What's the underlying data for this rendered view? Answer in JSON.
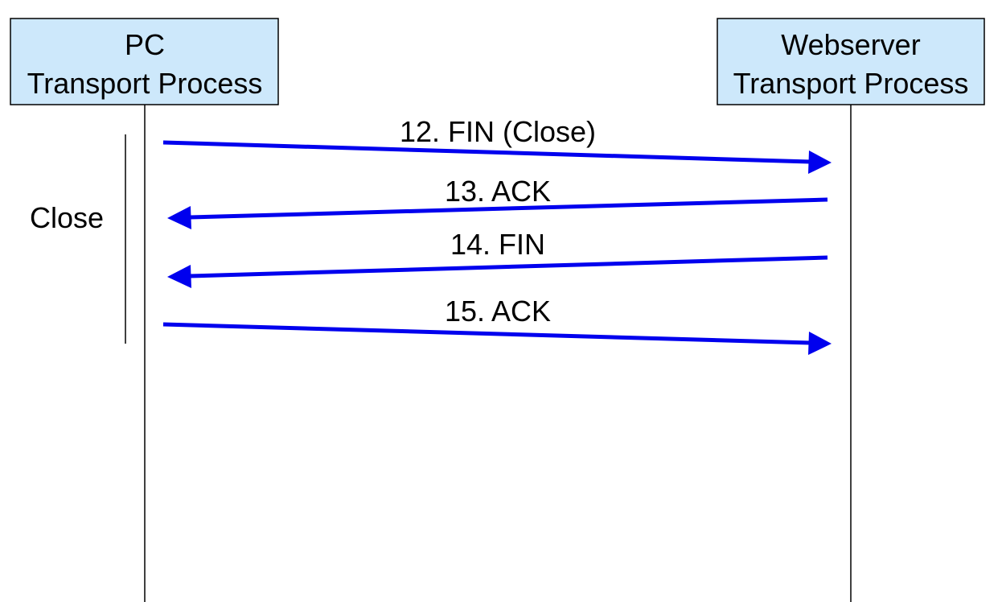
{
  "colors": {
    "participant_fill": "#cde8fb",
    "participant_border": "#000000",
    "arrow": "#0000ee",
    "lifeline": "#000000"
  },
  "participants": [
    {
      "line1": "PC",
      "line2": "Transport Process"
    },
    {
      "line1": "Webserver",
      "line2": "Transport Process"
    }
  ],
  "phase": {
    "label": "Close"
  },
  "messages": [
    {
      "label": "12. FIN (Close)",
      "from": "PC",
      "to": "Webserver"
    },
    {
      "label": "13. ACK",
      "from": "Webserver",
      "to": "PC"
    },
    {
      "label": "14. FIN",
      "from": "Webserver",
      "to": "PC"
    },
    {
      "label": "15. ACK",
      "from": "PC",
      "to": "Webserver"
    }
  ]
}
